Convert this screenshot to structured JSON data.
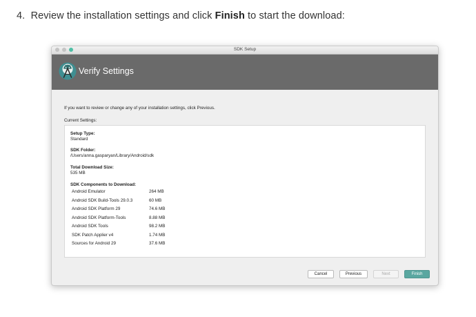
{
  "instruction": {
    "number": "4.",
    "before": "Review the installation settings and click ",
    "bold": "Finish",
    "after": " to start the download:"
  },
  "window": {
    "title": "SDK Setup"
  },
  "header": {
    "title": "Verify Settings",
    "icon": "android-studio-icon"
  },
  "intro_text": "If you want to review or change any of your installation settings, click Previous.",
  "current_settings_label": "Current Settings:",
  "settings": {
    "setup_type_label": "Setup Type:",
    "setup_type_value": "Standard",
    "sdk_folder_label": "SDK Folder:",
    "sdk_folder_value": "/Users/anna.gasparyan/Library/Android/sdk",
    "total_download_label": "Total Download Size:",
    "total_download_value": "535 MB",
    "components_label": "SDK Components to Download:"
  },
  "components": [
    {
      "name": "Android Emulator",
      "size": "264 MB"
    },
    {
      "name": "Android SDK Build-Tools 29.0.3",
      "size": "60 MB"
    },
    {
      "name": "Android SDK Platform 29",
      "size": "74.6 MB"
    },
    {
      "name": "Android SDK Platform-Tools",
      "size": "8.88 MB"
    },
    {
      "name": "Android SDK Tools",
      "size": "98.2 MB"
    },
    {
      "name": "SDK Patch Applier v4",
      "size": "1.74 MB"
    },
    {
      "name": "Sources for Android 29",
      "size": "37.6 MB"
    }
  ],
  "buttons": {
    "cancel": "Cancel",
    "previous": "Previous",
    "next": "Next",
    "finish": "Finish"
  },
  "colors": {
    "banner": "#6a6a6a",
    "finish_button": "#5aa7a0",
    "logo_circle": "#3f8f92"
  }
}
